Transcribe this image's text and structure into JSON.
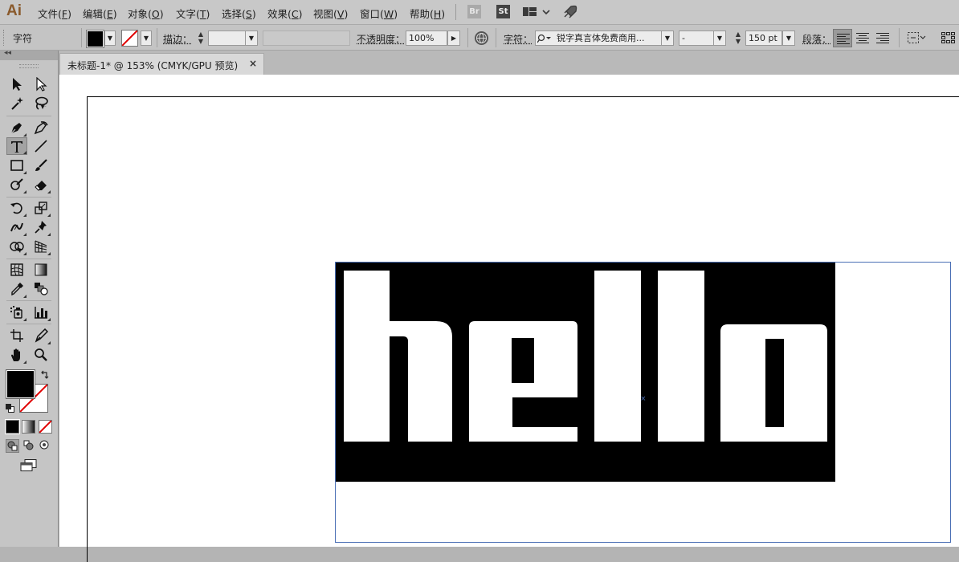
{
  "app": {
    "logo": "Ai"
  },
  "menu": {
    "items": [
      {
        "label": "文件(",
        "key": "F",
        "end": ")"
      },
      {
        "label": "编辑(",
        "key": "E",
        "end": ")"
      },
      {
        "label": "对象(",
        "key": "O",
        "end": ")"
      },
      {
        "label": "文字(",
        "key": "T",
        "end": ")"
      },
      {
        "label": "选择(",
        "key": "S",
        "end": ")"
      },
      {
        "label": "效果(",
        "key": "C",
        "end": ")"
      },
      {
        "label": "视图(",
        "key": "V",
        "end": ")"
      },
      {
        "label": "窗口(",
        "key": "W",
        "end": ")"
      },
      {
        "label": "帮助(",
        "key": "H",
        "end": ")"
      }
    ],
    "bridge": "Br",
    "stock": "St"
  },
  "control": {
    "title": "字符",
    "stroke_label": "描边：",
    "opacity_label": "不透明度：",
    "opacity_value": "100%",
    "char_label": "字符：",
    "font_name": "锐字真言体免费商用...",
    "font_style": "-",
    "font_size": "150 pt",
    "para_label": "段落：",
    "fill_color": "#000000",
    "stroke_color": "none"
  },
  "document": {
    "tab_title": "未标题-1* @ 153% (CMYK/GPU 预览)",
    "tab_close": "×",
    "artwork_text": "hello"
  },
  "icons": [
    "selection-tool-icon",
    "direct-selection-tool-icon",
    "magic-wand-icon",
    "lasso-icon",
    "pen-tool-icon",
    "curvature-tool-icon",
    "type-tool-icon",
    "line-tool-icon",
    "rectangle-tool-icon",
    "paintbrush-icon",
    "shaper-tool-icon",
    "eraser-icon",
    "rotate-tool-icon",
    "scale-tool-icon",
    "warp-tool-icon",
    "puppet-warp-icon",
    "shape-builder-icon",
    "perspective-grid-icon",
    "mesh-tool-icon",
    "gradient-tool-icon",
    "eyedropper-icon",
    "blend-tool-icon",
    "symbol-sprayer-icon",
    "column-graph-icon",
    "artboard-tool-icon",
    "slice-tool-icon",
    "hand-tool-icon",
    "zoom-tool-icon"
  ]
}
